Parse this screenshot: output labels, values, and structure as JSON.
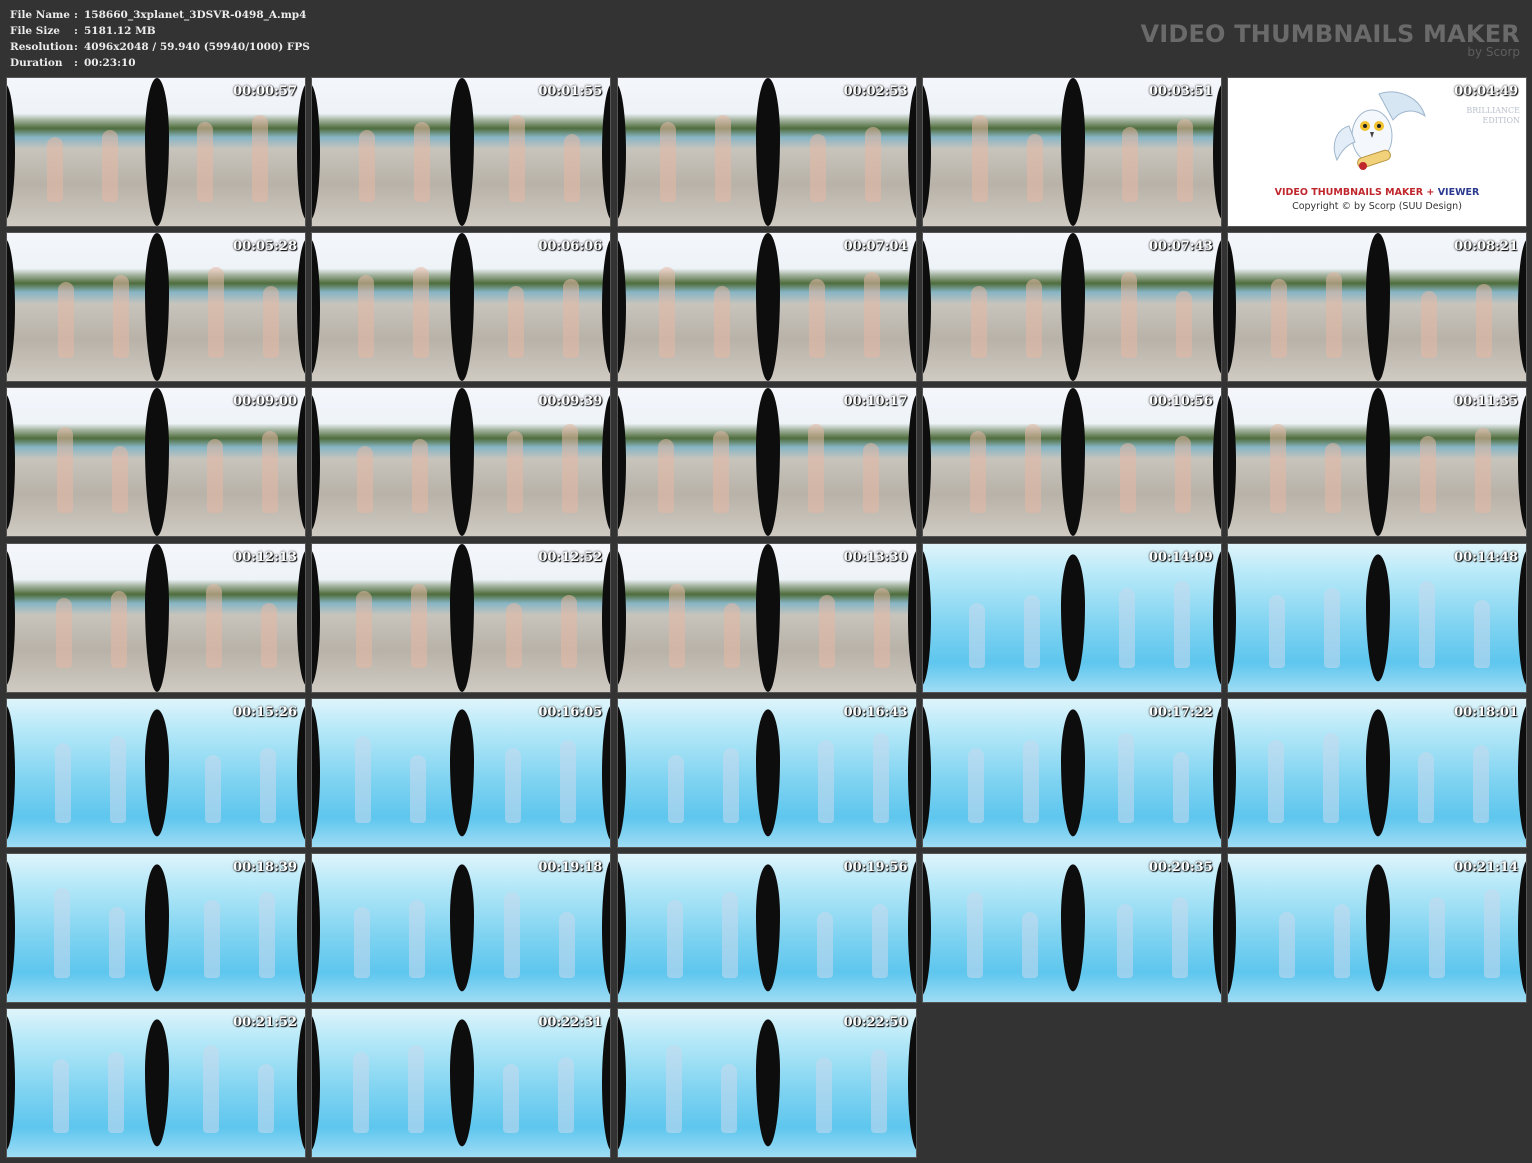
{
  "info": {
    "rows": [
      {
        "label": "File Name",
        "sep": ":",
        "value": "158660_3xplanet_3DSVR-0498_A.mp4"
      },
      {
        "label": "File Size",
        "sep": ":",
        "value": "5181.12 MB"
      },
      {
        "label": "Resolution",
        "sep": ":",
        "value": "4096x2048 / 59.940 (59940/1000) FPS"
      },
      {
        "label": "Duration",
        "sep": ":",
        "value": "00:23:10"
      }
    ]
  },
  "brand": {
    "title": "VIDEO THUMBNAILS MAKER",
    "subtitle": "by Scorp"
  },
  "logo_tile": {
    "timestamp": "00:04:49",
    "edition_line1": "BRILLIANCE",
    "edition_line2": "EDITION",
    "product_red": "VIDEO THUMBNAILS MAKER",
    "product_plus": "+",
    "product_blue": "VIEWER",
    "copyright": "Copyright © by Scorp (SUU Design)"
  },
  "thumbnails": [
    {
      "time": "00:00:57",
      "scene": "pool"
    },
    {
      "time": "00:01:55",
      "scene": "pool"
    },
    {
      "time": "00:02:53",
      "scene": "pool"
    },
    {
      "time": "00:03:51",
      "scene": "pool"
    },
    {
      "time": "00:04:49",
      "scene": "logo"
    },
    {
      "time": "00:05:28",
      "scene": "pool"
    },
    {
      "time": "00:06:06",
      "scene": "pool"
    },
    {
      "time": "00:07:04",
      "scene": "pool"
    },
    {
      "time": "00:07:43",
      "scene": "pool"
    },
    {
      "time": "00:08:21",
      "scene": "pool"
    },
    {
      "time": "00:09:00",
      "scene": "pool"
    },
    {
      "time": "00:09:39",
      "scene": "pool"
    },
    {
      "time": "00:10:17",
      "scene": "pool"
    },
    {
      "time": "00:10:56",
      "scene": "pool"
    },
    {
      "time": "00:11:35",
      "scene": "pool"
    },
    {
      "time": "00:12:13",
      "scene": "pool"
    },
    {
      "time": "00:12:52",
      "scene": "pool"
    },
    {
      "time": "00:13:30",
      "scene": "pool"
    },
    {
      "time": "00:14:09",
      "scene": "under"
    },
    {
      "time": "00:14:48",
      "scene": "under"
    },
    {
      "time": "00:15:26",
      "scene": "under"
    },
    {
      "time": "00:16:05",
      "scene": "under"
    },
    {
      "time": "00:16:43",
      "scene": "under"
    },
    {
      "time": "00:17:22",
      "scene": "under"
    },
    {
      "time": "00:18:01",
      "scene": "under"
    },
    {
      "time": "00:18:39",
      "scene": "under"
    },
    {
      "time": "00:19:18",
      "scene": "under"
    },
    {
      "time": "00:19:56",
      "scene": "under"
    },
    {
      "time": "00:20:35",
      "scene": "under"
    },
    {
      "time": "00:21:14",
      "scene": "under"
    },
    {
      "time": "00:21:52",
      "scene": "under"
    },
    {
      "time": "00:22:31",
      "scene": "under"
    },
    {
      "time": "00:22:50",
      "scene": "under"
    }
  ]
}
